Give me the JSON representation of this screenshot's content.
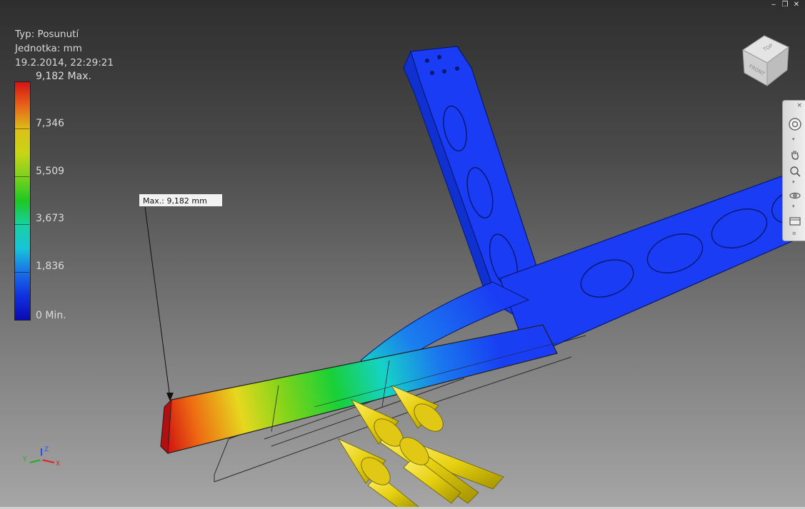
{
  "window": {
    "minimize_glyph": "‒",
    "restore_glyph": "❐",
    "close_glyph": "✕"
  },
  "legend": {
    "type_line": "Typ: Posunutí",
    "unit_line": "Jednotka: mm",
    "date_line": "19.2.2014, 22:29:21",
    "max_label": "9,182 Max.",
    "values": [
      "7,346",
      "5,509",
      "3,673",
      "1,836"
    ],
    "min_label": "0 Min.",
    "colors": {
      "max": "#d41414",
      "high": "#dcc018",
      "mid": "#1ec824",
      "low": "#16c4d8",
      "min": "#0a0ab4"
    }
  },
  "probe": {
    "label": "Max.: 9,182 mm"
  },
  "viewcube": {
    "face_front": "FRONT",
    "face_top": "TOP",
    "icon": "viewcube-icon"
  },
  "navbar": {
    "close_glyph": "×",
    "tools": [
      "steering-wheel-icon",
      "pan-icon",
      "zoom-icon",
      "orbit-icon",
      "view-window-icon"
    ]
  },
  "axis": {
    "x": "X",
    "y": "Y",
    "z": "Z"
  }
}
